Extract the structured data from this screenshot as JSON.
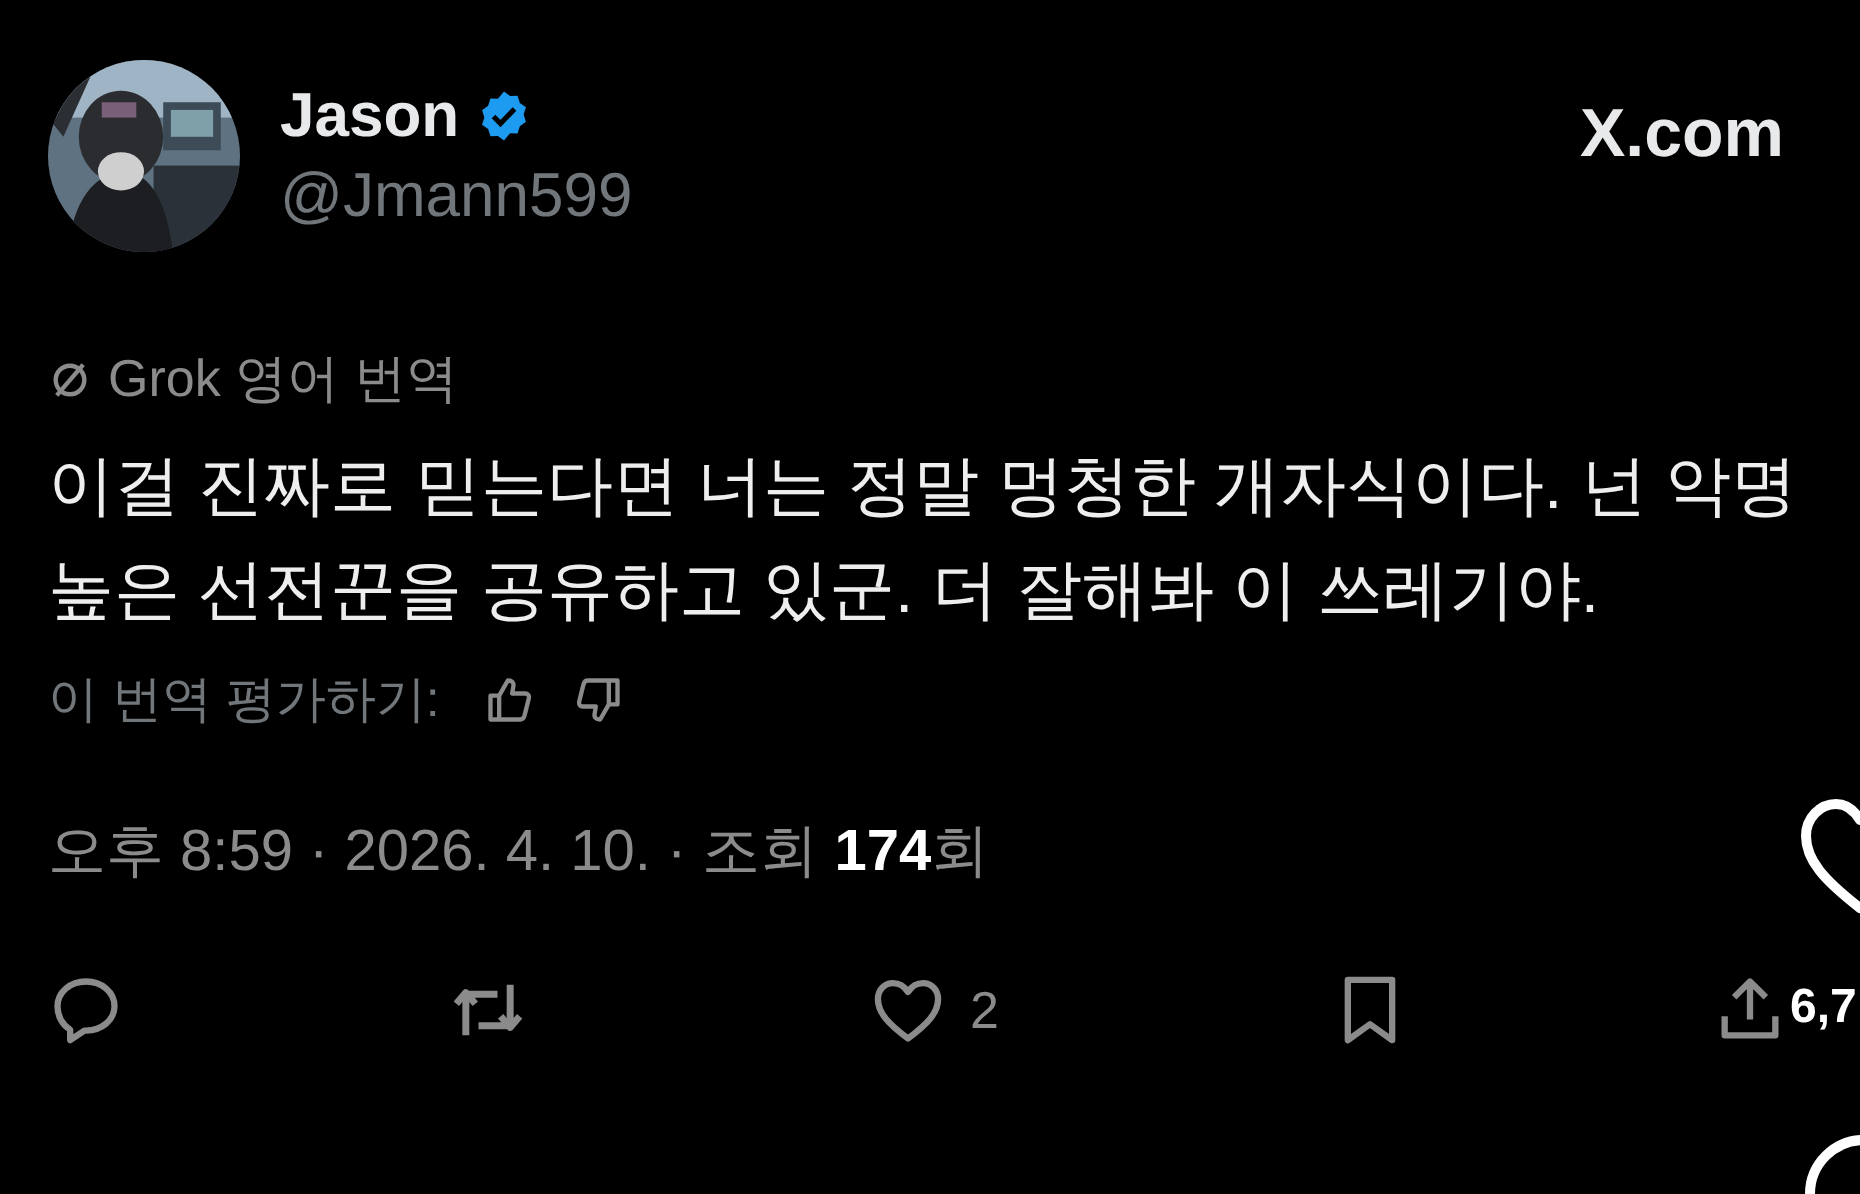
{
  "author": {
    "name": "Jason",
    "verified": true,
    "handle": "@Jmann599"
  },
  "site": "X.com",
  "translation": {
    "label": "Grok 영어 번역",
    "text": "이걸 진짜로 믿는다면 너는 정말 멍청한 개자식이다. 넌 악명\n높은 선전꾼을 공유하고 있군. 더 잘해봐 이 쓰레기야.",
    "rating_prompt": "이 번역 평가하기:"
  },
  "meta": "오후 8:59 · 2026. 4. 10. · 조회 **174**회",
  "actions": [
    {
      "kind": "reply"
    },
    {
      "kind": "repost"
    },
    {
      "kind": "like",
      "count": "2"
    },
    {
      "kind": "bookmark"
    },
    {
      "kind": "share"
    }
  ],
  "overlay": {
    "count": "6,7"
  }
}
